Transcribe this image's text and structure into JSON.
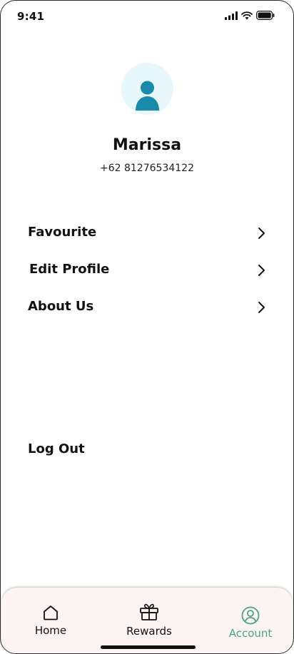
{
  "status_bar": {
    "time": "9:41"
  },
  "profile": {
    "name": "Marissa",
    "phone": "+62 81276534122"
  },
  "menu": [
    {
      "label": "Favourite"
    },
    {
      "label": "Edit Profile"
    },
    {
      "label": "About Us"
    }
  ],
  "logout_label": "Log Out",
  "tabs": [
    {
      "label": "Home",
      "icon": "home-icon"
    },
    {
      "label": "Rewards",
      "icon": "gift-icon"
    },
    {
      "label": "Account",
      "icon": "account-icon",
      "active": true
    }
  ],
  "colors": {
    "accent": "#1a8aaa",
    "active_tab": "#4aa38a",
    "tab_bar_bg": "#fbf4f3",
    "avatar_bg": "#e8f7fb"
  }
}
